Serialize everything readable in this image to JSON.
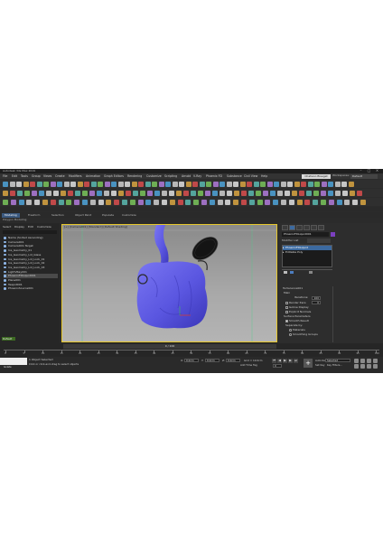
{
  "window": {
    "title": "Autodesk 3ds Max 2019"
  },
  "menu": [
    "File",
    "Edit",
    "Tools",
    "Group",
    "Views",
    "Create",
    "Modifiers",
    "Animation",
    "Graph Editors",
    "Rendering",
    "Customize",
    "Scripting",
    "Arnold",
    "V-Ray",
    "Phoenix FD",
    "Substance",
    "Civil View",
    "Help"
  ],
  "signin": "Chatwoo Biseget",
  "workspace": {
    "label": "Workspaces:",
    "value": "Default"
  },
  "ribbon": {
    "tabs": [
      "Modeling",
      "Freeform",
      "Selection",
      "Object Paint",
      "Populate",
      "Customize"
    ],
    "active": 0,
    "sublabel": "Polygon Modeling"
  },
  "scene_explorer": {
    "menu": [
      "Select",
      "Display",
      "Edit",
      "Customize"
    ],
    "rows": [
      {
        "label": "Name (Sorted Ascending)",
        "selected": false
      },
      {
        "label": "Camera001",
        "selected": false
      },
      {
        "label": "Camera001.Target",
        "selected": false
      },
      {
        "label": "Ice_Geometry_01",
        "selected": false
      },
      {
        "label": "Ice_Geometry_Lid_Glass",
        "selected": false
      },
      {
        "label": "Ice_Geometry_Lid_Lock_01",
        "selected": false
      },
      {
        "label": "Ice_Geometry_Lid_Lock_02",
        "selected": false
      },
      {
        "label": "Ice_Geometry_Lid_Lock_03",
        "selected": false
      },
      {
        "label": "LightVRay001",
        "selected": false
      },
      {
        "label": "PhoenixFDLiquid001",
        "selected": true
      },
      {
        "label": "Plane001",
        "selected": false
      },
      {
        "label": "Teapot001",
        "selected": false
      },
      {
        "label": "PhoenixSource001",
        "selected": false
      }
    ],
    "layer": "Default"
  },
  "viewport": {
    "label": "[+] [Camera001] [Standard] [Default Shading]"
  },
  "command_panel": {
    "object_name": "PhoenixFDLiquid001",
    "modifier_list_label": "Modifier List",
    "stack": [
      "PhoenixFDLiquid",
      "Editable Poly"
    ],
    "rollout": {
      "title": "Turbulence001",
      "group": "Main",
      "fields": [
        {
          "label": "Iterations:",
          "value": "100"
        },
        {
          "label": "Render Iters:",
          "value": "0"
        }
      ],
      "checks": [
        "Isoline Display",
        "Explicit Normals"
      ],
      "surface_label": "Surface Parameters",
      "smooth_result": "Smooth Result",
      "separate_by": "Separate by:",
      "radios": [
        "Materials",
        "Smoothing Groups"
      ]
    }
  },
  "timeline": {
    "slider_text": "0 / 100",
    "ticks": [
      "0",
      "5",
      "10",
      "15",
      "20",
      "25",
      "30",
      "35",
      "40",
      "45",
      "50",
      "55",
      "60",
      "65",
      "70",
      "75",
      "80",
      "85",
      "90",
      "95",
      "100"
    ]
  },
  "status": {
    "selected": "1 Object Selected",
    "prompt": "Click or click-and-drag to select objects",
    "x_label": "X:",
    "x_value": "0.0cm",
    "y_label": "Y:",
    "y_value": "0.0cm",
    "z_label": "Z:",
    "z_value": "0.0cm",
    "grid": "Grid = 10.0cm",
    "add_time_tag": "Add Time Tag",
    "autokey": "Auto Key",
    "selected_dropdown": "Selected",
    "setkey": "Set Key",
    "key_filters": "Key Filters...",
    "frame": "0",
    "isolate": "Isolate"
  },
  "colors": {
    "viewport_border": "#e6c72b",
    "model": "#5a56e0",
    "selection_accent": "#3c6aa0"
  }
}
